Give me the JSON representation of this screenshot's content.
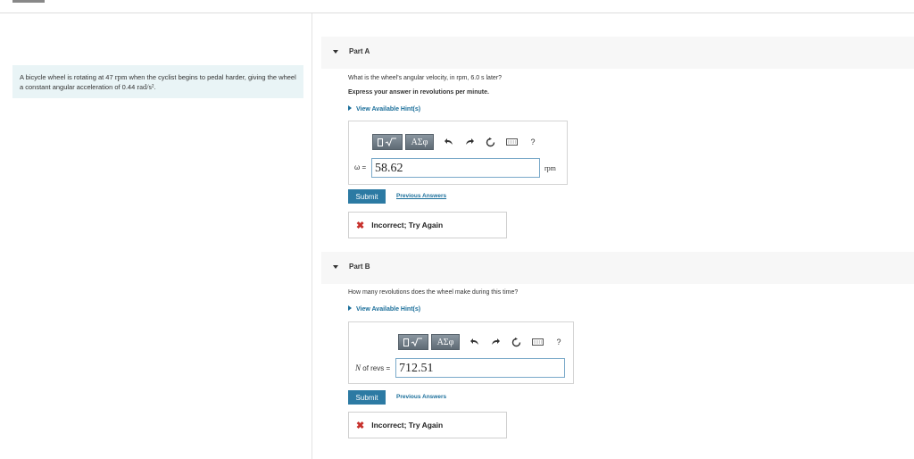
{
  "problem": {
    "text_1": "A bicycle wheel is rotating at 47",
    "unit_1": "rpm",
    "text_2": "when the cyclist begins to pedal harder, giving the wheel a constant angular acceleration of 0.44",
    "unit_2": "rad/s²",
    "text_3": "."
  },
  "parts": [
    {
      "title": "Part A",
      "question": "What is the wheel's angular velocity, in rpm, 6.0 s later?",
      "instruction": "Express your answer in revolutions per minute.",
      "hint_label": "View Available Hint(s)",
      "toolbar": {
        "greek_label": "ΑΣφ",
        "help_label": "?"
      },
      "variable_label": "ω =",
      "answer_value": "58.62",
      "unit": "rpm",
      "submit_label": "Submit",
      "previous_label": "Previous Answers",
      "feedback": "Incorrect; Try Again",
      "feedback_icon": "x-icon"
    },
    {
      "title": "Part B",
      "question": "How many revolutions does the wheel make during this time?",
      "hint_label": "View Available Hint(s)",
      "toolbar": {
        "greek_label": "ΑΣφ",
        "help_label": "?"
      },
      "variable_label_var": "N",
      "variable_label_rest": "of revs =",
      "answer_value": "712.51",
      "submit_label": "Submit",
      "previous_label": "Previous Answers",
      "feedback": "Incorrect; Try Again",
      "feedback_icon": "x-icon"
    }
  ],
  "colors": {
    "accent": "#2c7aa3",
    "link": "#1a6e9a",
    "error": "#c7312c",
    "problem_bg": "#e9f4f6"
  }
}
